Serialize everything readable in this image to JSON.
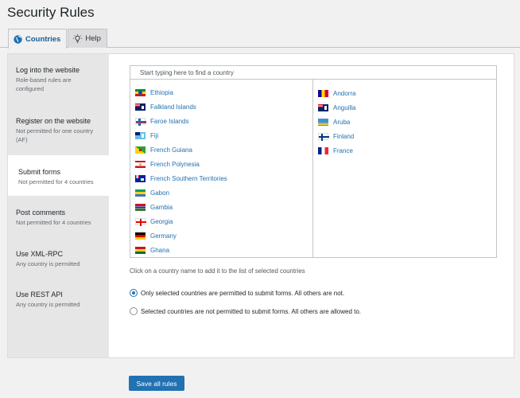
{
  "page": {
    "title": "Security Rules"
  },
  "tabs": [
    {
      "label": "Countries",
      "icon": "globe-icon",
      "active": true
    },
    {
      "label": "Help",
      "icon": "lightbulb-icon",
      "active": false
    }
  ],
  "rules": [
    {
      "title": "Log into the website",
      "subtitle": "Role-based rules are configured"
    },
    {
      "title": "Register on the website",
      "subtitle": "Not permitted for one country (AF)"
    },
    {
      "title": "Submit forms",
      "subtitle": "Not permitted for 4 countries",
      "active": true
    },
    {
      "title": "Post comments",
      "subtitle": "Not permitted for 4 countries"
    },
    {
      "title": "Use XML-RPC",
      "subtitle": "Any country is permitted"
    },
    {
      "title": "Use REST API",
      "subtitle": "Any country is permitted"
    }
  ],
  "search": {
    "placeholder": "Start typing here to find a country"
  },
  "available_countries": [
    "Ethiopia",
    "Falkland Islands",
    "Faroe Islands",
    "Fiji",
    "French Guiana",
    "French Polynesia",
    "French Southern Territories",
    "Gabon",
    "Gambia",
    "Georgia",
    "Germany",
    "Ghana"
  ],
  "selected_countries": [
    "Andorra",
    "Anguilla",
    "Aruba",
    "Finland",
    "France"
  ],
  "hint": "Click on a country name to add it to the list of selected countries",
  "options": [
    {
      "label": "Only selected countries are permitted to submit forms. All others are not.",
      "checked": true
    },
    {
      "label": "Selected countries are not permitted to submit forms. All others are allowed to.",
      "checked": false
    }
  ],
  "save_label": "Save all rules",
  "colors": {
    "accent": "#2271b1",
    "sidebar": "#e6e6e6",
    "background": "#f1f1f1"
  }
}
